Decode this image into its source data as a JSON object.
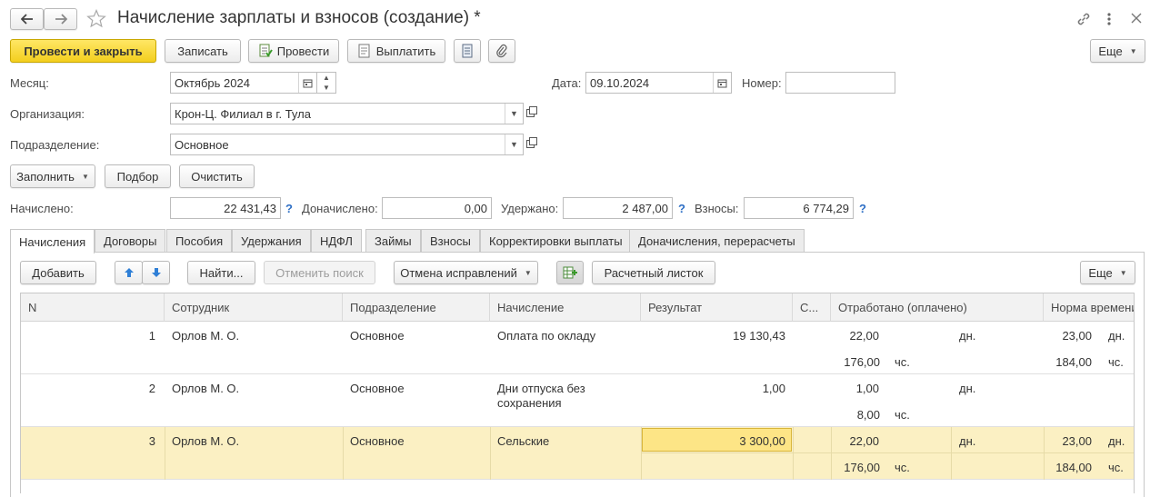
{
  "window": {
    "title": "Начисление зарплаты и взносов (создание) *"
  },
  "toolbar": {
    "post_close": "Провести и закрыть",
    "save": "Записать",
    "post": "Провести",
    "pay": "Выплатить",
    "more": "Еще"
  },
  "form": {
    "month_label": "Месяц:",
    "month_value": "Октябрь 2024",
    "date_label": "Дата:",
    "date_value": "09.10.2024",
    "number_label": "Номер:",
    "number_value": "",
    "org_label": "Организация:",
    "org_value": "Крон-Ц. Филиал в г. Тула",
    "dept_label": "Подразделение:",
    "dept_value": "Основное"
  },
  "actions": {
    "fill": "Заполнить",
    "select": "Подбор",
    "clear": "Очистить"
  },
  "totals": {
    "accrued_label": "Начислено:",
    "accrued_value": "22 431,43",
    "extra_label": "Доначислено:",
    "extra_value": "0,00",
    "withheld_label": "Удержано:",
    "withheld_value": "2 487,00",
    "contrib_label": "Взносы:",
    "contrib_value": "6 774,29",
    "help": "?"
  },
  "tabs": [
    {
      "label": "Начисления"
    },
    {
      "label": "Договоры"
    },
    {
      "label": "Пособия"
    },
    {
      "label": "Удержания"
    },
    {
      "label": "НДФЛ"
    },
    {
      "label": "Займы"
    },
    {
      "label": "Взносы"
    },
    {
      "label": "Корректировки выплаты"
    },
    {
      "label": "Доначисления, перерасчеты"
    }
  ],
  "grid_toolbar": {
    "add": "Добавить",
    "find": "Найти...",
    "cancel_search": "Отменить поиск",
    "cancel_fix": "Отмена исправлений",
    "payslip": "Расчетный листок",
    "more": "Еще"
  },
  "grid": {
    "columns": [
      "N",
      "Сотрудник",
      "Подразделение",
      "Начисление",
      "Результат",
      "С...",
      "Отработано (оплачено)",
      "Норма времени"
    ],
    "rows": [
      {
        "n": "1",
        "employee": "Орлов М. О.",
        "dept": "Основное",
        "accrual": "Оплата по окладу",
        "result": "19 130,43",
        "worked_days": "22,00",
        "days_unit": "дн.",
        "worked_hours": "176,00",
        "hours_unit": "чс.",
        "norm_days": "23,00",
        "norm_days_unit": "дн.",
        "norm_hours": "184,00",
        "norm_hours_unit": "чс."
      },
      {
        "n": "2",
        "employee": "Орлов М. О.",
        "dept": "Основное",
        "accrual": "Дни отпуска без сохранения",
        "result": "1,00",
        "worked_days": "1,00",
        "days_unit": "дн.",
        "worked_hours": "8,00",
        "hours_unit": "чс.",
        "norm_days": "",
        "norm_days_unit": "",
        "norm_hours": "",
        "norm_hours_unit": ""
      },
      {
        "n": "3",
        "employee": "Орлов М. О.",
        "dept": "Основное",
        "accrual": "Сельские",
        "result": "3 300,00",
        "worked_days": "22,00",
        "days_unit": "дн.",
        "worked_hours": "176,00",
        "hours_unit": "чс.",
        "norm_days": "23,00",
        "norm_days_unit": "дн.",
        "norm_hours": "184,00",
        "norm_hours_unit": "чс."
      }
    ]
  },
  "colors": {
    "primary_button": "#f3cf1e",
    "selected_row": "#fbf0c3",
    "selected_cell": "#fde586",
    "help_link": "#2e6fc5"
  },
  "icons": [
    "back-arrow-icon",
    "forward-arrow-icon",
    "star-icon",
    "link-icon",
    "kebab-menu-icon",
    "close-icon",
    "post-doc-icon",
    "pay-doc-icon",
    "report-icon",
    "paperclip-icon",
    "calendar-icon",
    "dropdown-icon",
    "open-icon",
    "arrow-up-icon",
    "arrow-down-icon",
    "grid-settings-icon"
  ]
}
